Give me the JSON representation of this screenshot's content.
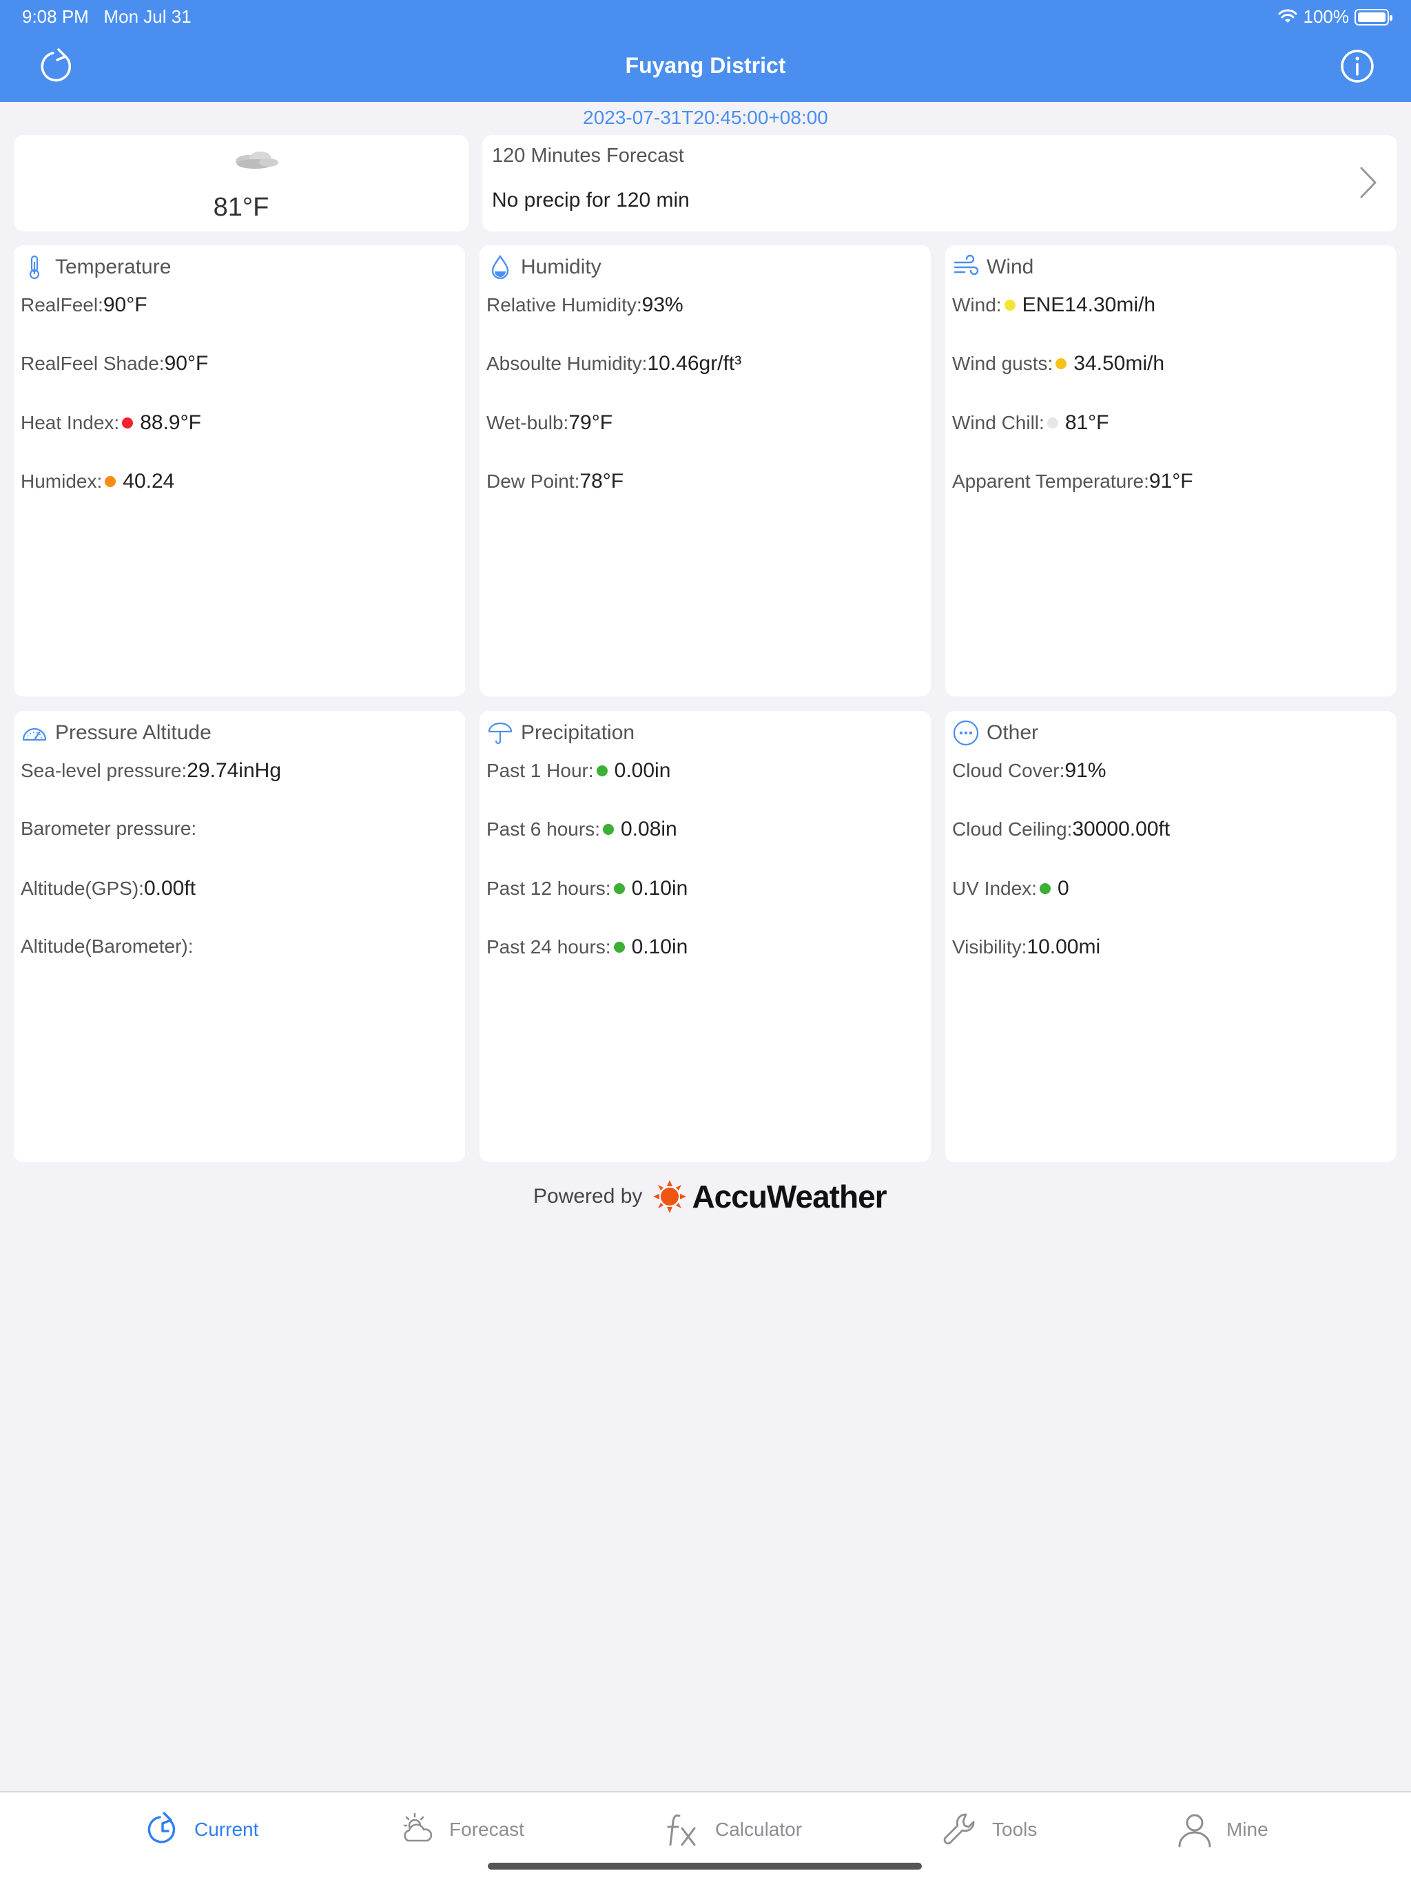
{
  "status_bar": {
    "time": "9:08 PM",
    "date": "Mon Jul 31",
    "battery": "100%"
  },
  "nav": {
    "title": "Fuyang District",
    "refresh_icon": "refresh-icon",
    "info_icon": "info-icon"
  },
  "timestamp": "2023-07-31T20:45:00+08:00",
  "current": {
    "temperature": "81°F",
    "condition_icon": "cloudy-icon"
  },
  "minute_forecast": {
    "title": "120 Minutes Forecast",
    "summary": "No precip for 120 min"
  },
  "colors": {
    "accent": "#4a8ff0",
    "red": "#f5222d",
    "orange": "#fa8c16",
    "yellow": "#f2e535",
    "gold": "#f6c21a",
    "gray": "#e6e6e6",
    "green": "#3cb034"
  },
  "panels": {
    "temperature": {
      "title": "Temperature",
      "rows": [
        {
          "label": "RealFeel:",
          "value": "90°F"
        },
        {
          "label": "RealFeel Shade:",
          "value": "90°F"
        },
        {
          "label": "Heat Index:",
          "value": "88.9°F",
          "dot": "red"
        },
        {
          "label": "Humidex:",
          "value": "40.24",
          "dot": "orange"
        }
      ]
    },
    "humidity": {
      "title": "Humidity",
      "rows": [
        {
          "label": "Relative Humidity:",
          "value": "93%"
        },
        {
          "label": "Absoulte Humidity:",
          "value": "10.46gr/ft³"
        },
        {
          "label": "Wet-bulb:",
          "value": "79°F"
        },
        {
          "label": "Dew Point:",
          "value": "78°F"
        }
      ]
    },
    "wind": {
      "title": "Wind",
      "rows": [
        {
          "label": "Wind:",
          "value": "ENE14.30mi/h",
          "dot": "yellow"
        },
        {
          "label": "Wind gusts:",
          "value": "34.50mi/h",
          "dot": "gold"
        },
        {
          "label": "Wind Chill:",
          "value": "81°F",
          "dot": "gray"
        },
        {
          "label": "Apparent Temperature:",
          "value": "91°F"
        }
      ]
    },
    "pressure": {
      "title": "Pressure Altitude",
      "rows": [
        {
          "label": "Sea-level pressure:",
          "value": "29.74inHg"
        },
        {
          "label": "Barometer pressure:",
          "value": ""
        },
        {
          "label": "Altitude(GPS):",
          "value": "0.00ft"
        },
        {
          "label": "Altitude(Barometer):",
          "value": ""
        }
      ]
    },
    "precipitation": {
      "title": "Precipitation",
      "rows": [
        {
          "label": "Past 1 Hour:",
          "value": "0.00in",
          "dot": "green"
        },
        {
          "label": "Past 6 hours:",
          "value": "0.08in",
          "dot": "green"
        },
        {
          "label": "Past 12 hours:",
          "value": "0.10in",
          "dot": "green"
        },
        {
          "label": "Past 24 hours:",
          "value": "0.10in",
          "dot": "green"
        }
      ]
    },
    "other": {
      "title": "Other",
      "rows": [
        {
          "label": "Cloud Cover:",
          "value": "91%"
        },
        {
          "label": "Cloud Ceiling:",
          "value": "30000.00ft"
        },
        {
          "label": "UV Index:",
          "value": "0",
          "dot": "green"
        },
        {
          "label": "Visibility:",
          "value": "10.00mi"
        }
      ]
    }
  },
  "powered_by": {
    "prefix": "Powered by",
    "brand": "AccuWeather"
  },
  "tabs": [
    {
      "label": "Current",
      "icon": "current-icon",
      "active": true
    },
    {
      "label": "Forecast",
      "icon": "forecast-icon",
      "active": false
    },
    {
      "label": "Calculator",
      "icon": "fx-icon",
      "active": false
    },
    {
      "label": "Tools",
      "icon": "wrench-icon",
      "active": false
    },
    {
      "label": "Mine",
      "icon": "person-icon",
      "active": false
    }
  ]
}
